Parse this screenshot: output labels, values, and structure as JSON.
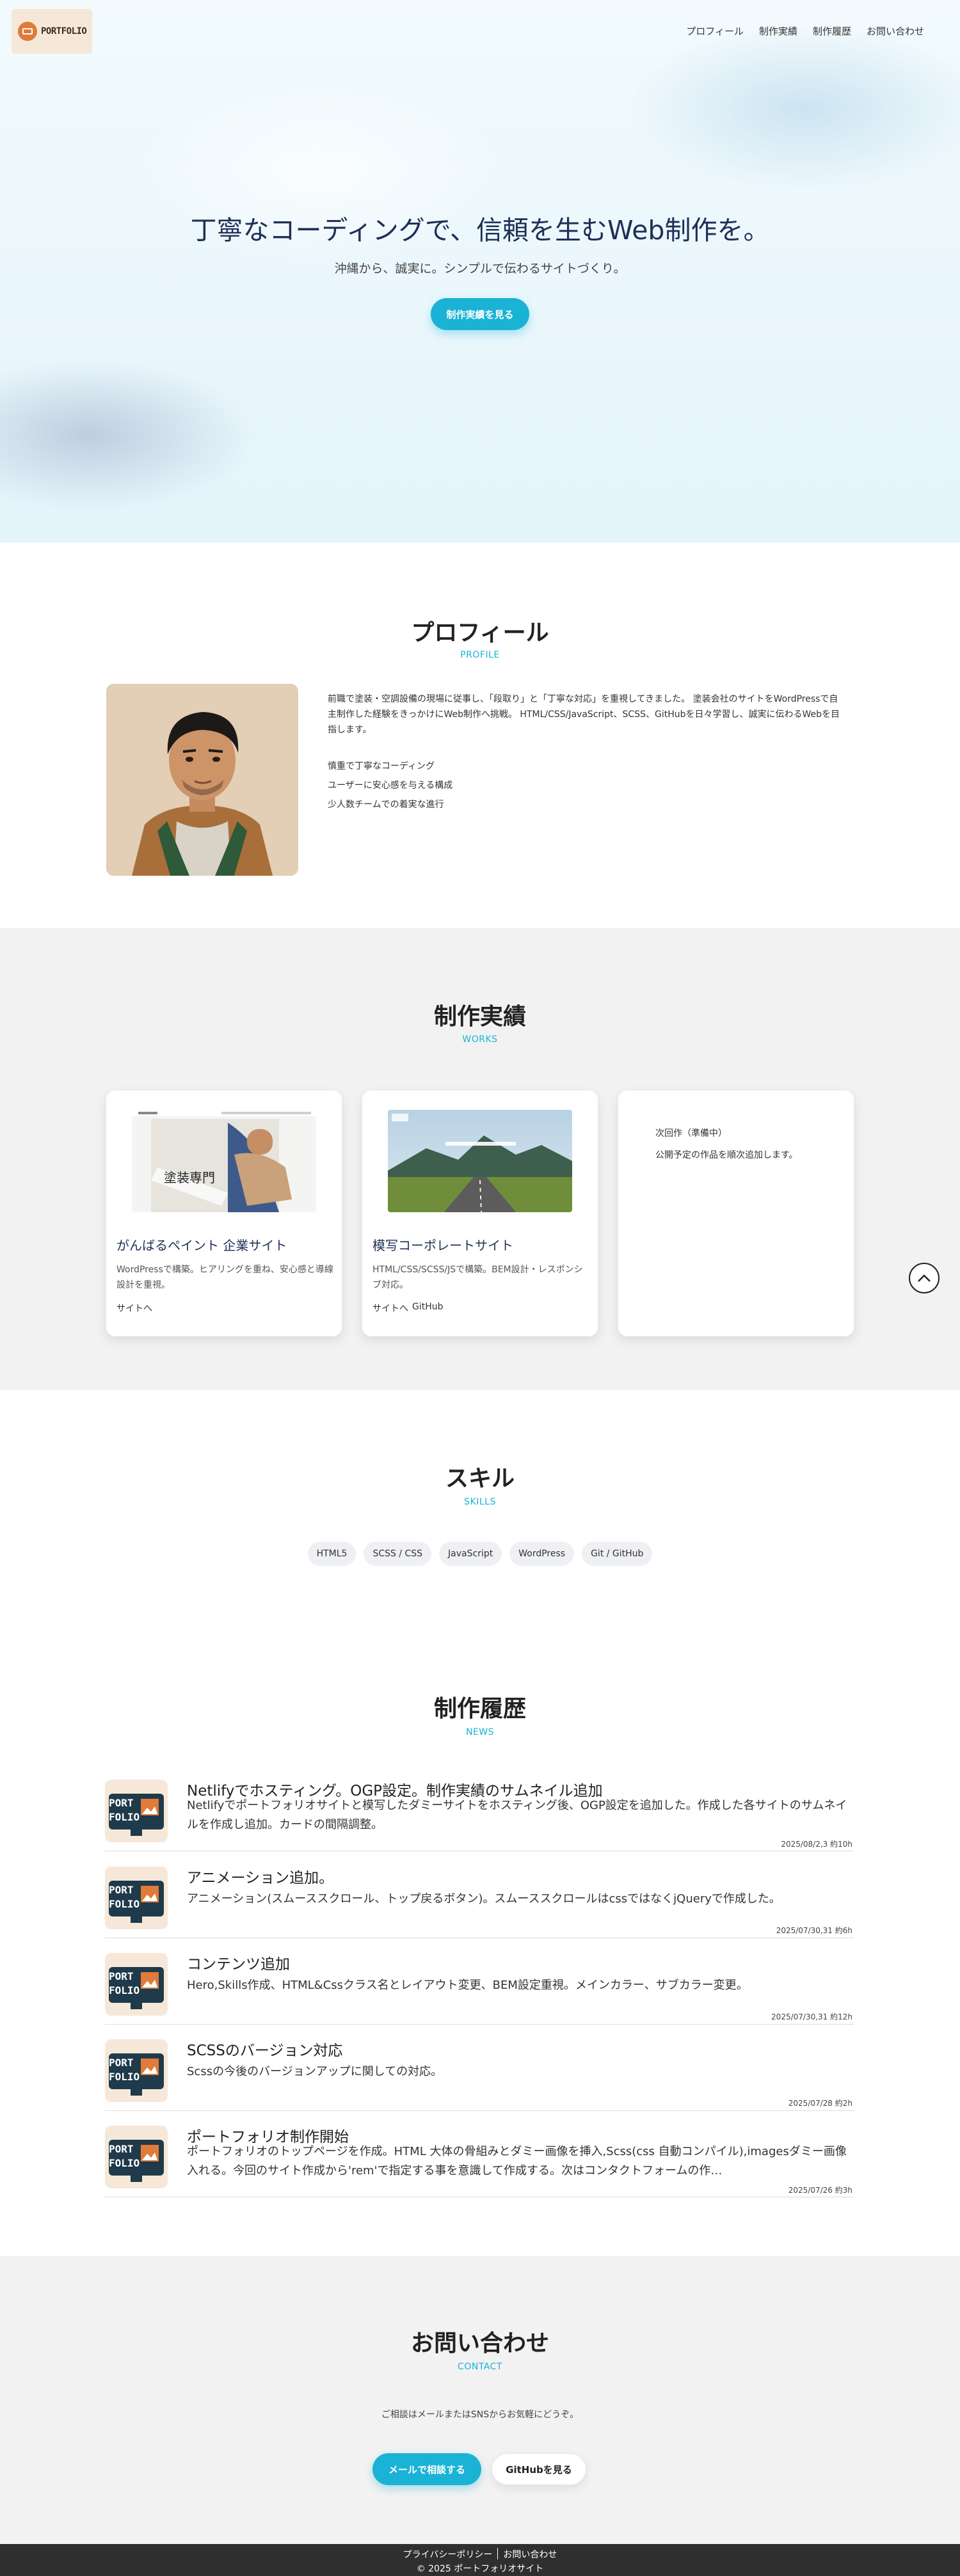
{
  "header": {
    "logo_text": "PORTFOLIO",
    "nav": [
      "プロフィール",
      "制作実績",
      "制作履歴",
      "お問い合わせ"
    ]
  },
  "hero": {
    "title": "丁寧なコーディングで、信頼を生むWeb制作を。",
    "subtitle": "沖縄から、誠実に。シンプルで伝わるサイトづくり。",
    "button": "制作実績を見る"
  },
  "profile": {
    "heading": "プロフィール",
    "heading_en": "PROFILE",
    "text": "前職で塗装・空調設備の現場に従事し、「段取り」と「丁寧な対応」を重視してきました。 塗装会社のサイトをWordPressで自主制作した経験をきっかけにWeb制作へ挑戦。 HTML/CSS/JavaScript、SCSS、GitHubを日々学習し、誠実に伝わるWebを目指します。",
    "points": [
      "慎重で丁寧なコーディング",
      "ユーザーに安心感を与える構成",
      "少人数チームでの着実な進行"
    ]
  },
  "works": {
    "heading": "制作実績",
    "heading_en": "WORKS",
    "cards": [
      {
        "title": "がんばるペイント 企業サイト",
        "desc": "WordPressで構築。ヒアリングを重ね、安心感と導線設計を重視。",
        "links": [
          "サイトへ"
        ],
        "thumb_text": "塗装専門"
      },
      {
        "title": "模写コーポレートサイト",
        "desc": "HTML/CSS/SCSS/JSで構築。BEM設計・レスポンシブ対応。",
        "links": [
          "サイトへ",
          "GitHub"
        ]
      },
      {
        "pending_title": "次回作（準備中）",
        "pending_desc": "公開予定の作品を順次追加します。"
      }
    ]
  },
  "skills": {
    "heading": "スキル",
    "heading_en": "SKILLS",
    "items": [
      "HTML5",
      "SCSS / CSS",
      "JavaScript",
      "WordPress",
      "Git / GitHub"
    ]
  },
  "news": {
    "heading": "制作履歴",
    "heading_en": "NEWS",
    "thumb_text": "PORT FOLIO",
    "items": [
      {
        "title": "Netlifyでホスティング。OGP設定。制作実績のサムネイル追加",
        "body": "Netlifyでポートフォリオサイトと模写したダミーサイトをホスティング後、OGP設定を追加した。作成した各サイトのサムネイルを作成し追加。カードの間隔調整。",
        "date": "2025/08/2,3 約10h"
      },
      {
        "title": "アニメーション追加。",
        "body": "アニメーション(スムーススクロール、トップ戻るボタン)。スムーススクロールはcssではなくjQueryで作成した。",
        "date": "2025/07/30,31 約6h"
      },
      {
        "title": "コンテンツ追加",
        "body": "Hero,Skills作成、HTML&Cssクラス名とレイアウト変更、BEM設定重視。メインカラー、サブカラー変更。",
        "date": "2025/07/30,31 約12h"
      },
      {
        "title": "SCSSのバージョン対応",
        "body": "Scssの今後のバージョンアップに関しての対応。",
        "date": "2025/07/28 約2h"
      },
      {
        "title": "ポートフォリオ制作開始",
        "body": "ポートフォリオのトップページを作成。HTML 大体の骨組みとダミー画像を挿入,Scss(css 自動コンパイル),imagesダミー画像入れる。今回のサイト作成から'rem'で指定する事を意識して作成する。次はコンタクトフォームの作…",
        "date": "2025/07/26 約3h"
      }
    ]
  },
  "contact": {
    "heading": "お問い合わせ",
    "heading_en": "CONTACT",
    "text": "ご相談はメールまたはSNSからお気軽にどうぞ。",
    "mail_button": "メールで相談する",
    "github_button": "GitHubを見る"
  },
  "footer": {
    "links": [
      "プライバシーポリシー",
      "お問い合わせ"
    ],
    "copyright": "© 2025 ポートフォリオサイト"
  },
  "colors": {
    "accent": "#1ab3d6",
    "title_navy": "#1f2f57",
    "footer_bg": "#2f2f2f"
  }
}
